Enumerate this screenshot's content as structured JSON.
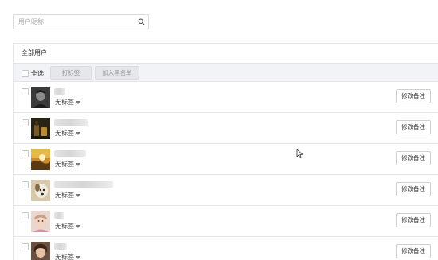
{
  "search": {
    "placeholder": "用户昵称",
    "icon": "search-icon"
  },
  "panel": {
    "title": "全部用户"
  },
  "toolbar": {
    "select_all_label": "全选",
    "tag_button_label": "打标签",
    "blacklist_button_label": "加入黑名单"
  },
  "users": [
    {
      "tag_label": "无标签",
      "remark_button_label": "修改备注",
      "avatar": "man-dark-portrait"
    },
    {
      "tag_label": "无标签",
      "remark_button_label": "修改备注",
      "avatar": "bottle-dark-portrait"
    },
    {
      "tag_label": "无标签",
      "remark_button_label": "修改备注",
      "avatar": "sunset-landscape"
    },
    {
      "tag_label": "无标签",
      "remark_button_label": "修改备注",
      "avatar": "dog-photo"
    },
    {
      "tag_label": "无标签",
      "remark_button_label": "修改备注",
      "avatar": "child-portrait"
    },
    {
      "tag_label": "无标签",
      "remark_button_label": "修改备注",
      "avatar": "woman-portrait"
    }
  ],
  "colors": {
    "border": "#e4e6eb",
    "toolbar_bg": "#f2f3f6",
    "disabled_text": "#9a9a9a"
  }
}
